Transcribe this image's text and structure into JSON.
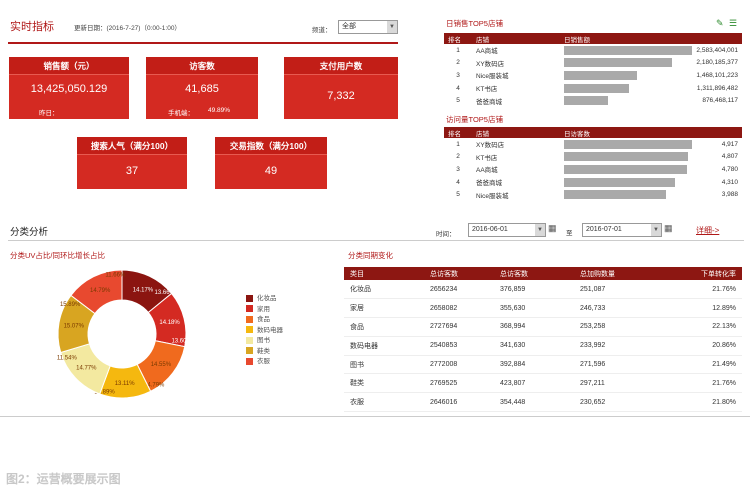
{
  "realtime": {
    "title": "实时指标",
    "update_label": "更新日期：(2016-7-27)（0:00-1:00）",
    "channel_label": "频道：",
    "channel_value": "全部",
    "kpis": [
      {
        "label": "销售额（元）",
        "value": "13,425,050.129",
        "sub_left": "昨日："
      },
      {
        "label": "访客数",
        "value": "41,685",
        "sub_left": "手机端：",
        "sub_right": "49.89%"
      },
      {
        "label": "支付用户数",
        "value": "7,332"
      },
      {
        "label": "搜索人气（满分100）",
        "value": "37"
      },
      {
        "label": "交易指数（满分100）",
        "value": "49"
      }
    ]
  },
  "top_sales": {
    "title": "日销售TOP5店铺",
    "headers": [
      "排名",
      "店铺",
      "日销售额"
    ],
    "rows": [
      {
        "rank": "1",
        "shop": "AA商城",
        "value": "2,583,404,001",
        "pct": 100
      },
      {
        "rank": "2",
        "shop": "XY数码店",
        "value": "2,180,185,377",
        "pct": 84
      },
      {
        "rank": "3",
        "shop": "Nice服装城",
        "value": "1,468,101,223",
        "pct": 57
      },
      {
        "rank": "4",
        "shop": "KT书店",
        "value": "1,311,896,482",
        "pct": 51
      },
      {
        "rank": "5",
        "shop": "爸爸商城",
        "value": "876,468,117",
        "pct": 34
      }
    ]
  },
  "top_visits": {
    "title": "访问量TOP5店铺",
    "headers": [
      "排名",
      "店铺",
      "日访客数"
    ],
    "rows": [
      {
        "rank": "1",
        "shop": "XY数码店",
        "value": "4,917",
        "pct": 100
      },
      {
        "rank": "2",
        "shop": "KT书店",
        "value": "4,807",
        "pct": 97
      },
      {
        "rank": "3",
        "shop": "AA商城",
        "value": "4,780",
        "pct": 96
      },
      {
        "rank": "4",
        "shop": "爸爸商城",
        "value": "4,310",
        "pct": 87
      },
      {
        "rank": "5",
        "shop": "Nice服装城",
        "value": "3,988",
        "pct": 80
      }
    ]
  },
  "category": {
    "title": "分类分析",
    "date_label": "时间：",
    "date_from": "2016-06-01",
    "to_label": "至",
    "date_to": "2016-07-01",
    "detail_link": "详细->"
  },
  "pie": {
    "title": "分类UV占比/同环比增长占比",
    "legend": [
      "化妆品",
      "家用",
      "食品",
      "数码电器",
      "图书",
      "鞋类",
      "衣服"
    ]
  },
  "chart_data": {
    "type": "pie",
    "title": "分类UV占比/同环比增长占比",
    "categories": [
      "化妆品",
      "家用",
      "食品",
      "数码电器",
      "图书",
      "鞋类",
      "衣服"
    ],
    "values": [
      14.18,
      14.18,
      14.55,
      13.11,
      14.77,
      15.07,
      14.79
    ],
    "inner_labels": [
      "14.17%",
      "14.18%",
      "14.55%",
      "13.11%",
      "14.77%",
      "15.07%",
      "14.79%"
    ],
    "outer_labels": [
      "13.66%",
      "13.60%",
      "14.79%",
      "13.89%",
      "11.54%",
      "15.89%",
      "11.66%"
    ],
    "colors": [
      "#8b1510",
      "#d42a22",
      "#f06a1e",
      "#f5b80f",
      "#f3e9a0",
      "#d8a521",
      "#e8492f"
    ]
  },
  "sales_change": {
    "title": "分类同期变化",
    "headers": [
      "类目",
      "总访客数",
      "总访客数",
      "总加购数量",
      "下单转化率"
    ],
    "rows": [
      [
        "化妆品",
        "2656234",
        "376,859",
        "251,087",
        "21.76%"
      ],
      [
        "家居",
        "2658082",
        "355,630",
        "246,733",
        "12.89%"
      ],
      [
        "食品",
        "2727694",
        "368,994",
        "253,258",
        "22.13%"
      ],
      [
        "数码电器",
        "2540853",
        "341,630",
        "233,992",
        "20.86%"
      ],
      [
        "图书",
        "2772008",
        "392,884",
        "271,596",
        "21.49%"
      ],
      [
        "鞋类",
        "2769525",
        "423,807",
        "297,211",
        "21.76%"
      ],
      [
        "衣服",
        "2646016",
        "354,448",
        "230,652",
        "21.80%"
      ]
    ]
  },
  "caption": "图2：运营概要展示图"
}
